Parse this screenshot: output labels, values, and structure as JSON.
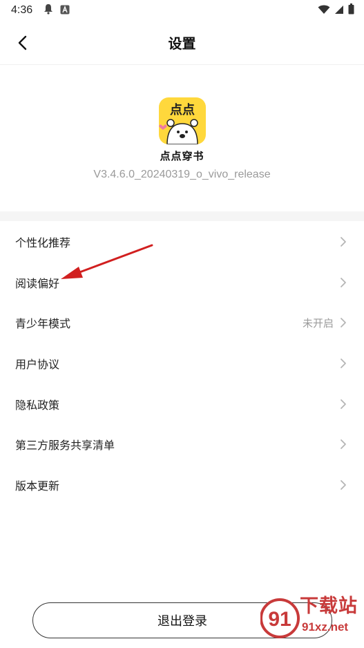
{
  "status_bar": {
    "time": "4:36"
  },
  "nav": {
    "title": "设置"
  },
  "app": {
    "logo_text": "点点",
    "name": "点点穿书",
    "version": "V3.4.6.0_20240319_o_vivo_release"
  },
  "settings": [
    {
      "label": "个性化推荐",
      "value": ""
    },
    {
      "label": "阅读偏好",
      "value": ""
    },
    {
      "label": "青少年模式",
      "value": "未开启"
    },
    {
      "label": "用户协议",
      "value": ""
    },
    {
      "label": "隐私政策",
      "value": ""
    },
    {
      "label": "第三方服务共享清单",
      "value": ""
    },
    {
      "label": "版本更新",
      "value": ""
    }
  ],
  "logout_label": "退出登录",
  "watermark": {
    "title": "下载站",
    "url": "91xz.net",
    "badge": "91"
  },
  "colors": {
    "logo_bg": "#ffd83c",
    "annotation_arrow": "#d11f1f",
    "watermark": "#c83a3a"
  }
}
